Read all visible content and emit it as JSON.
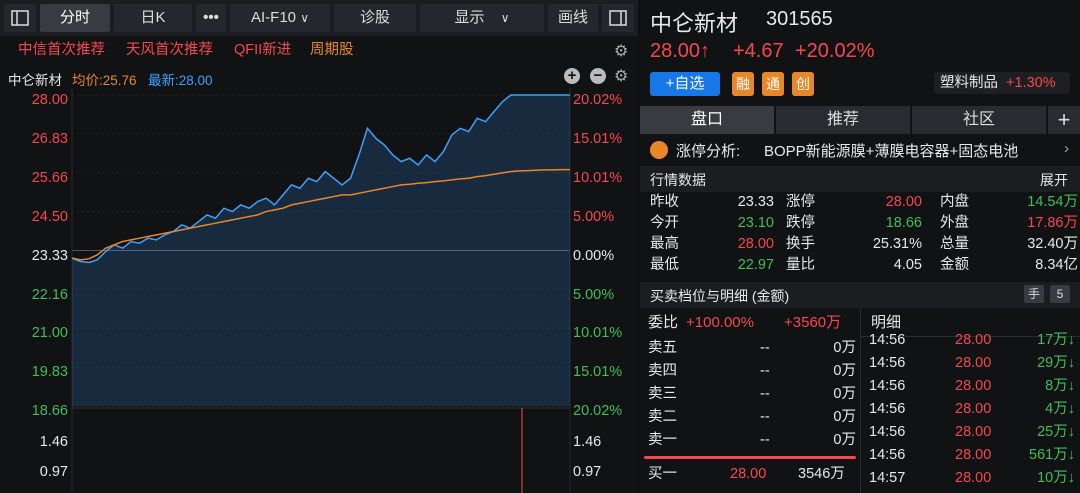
{
  "toolbar": {
    "tabs": [
      {
        "label": "分时",
        "active": true
      },
      {
        "label": "日K",
        "active": false
      },
      {
        "label": "•••",
        "active": false
      },
      {
        "label": "AI-F10",
        "active": false
      },
      {
        "label": "诊股",
        "active": false
      }
    ],
    "display_label": "显示",
    "draw_label": "画线"
  },
  "tags": [
    "中信首次推荐",
    "天风首次推荐",
    "QFII新进",
    "周期股"
  ],
  "chart_header": {
    "name": "中仑新材",
    "avg": "均价:25.76",
    "latest": "最新:28.00"
  },
  "chart_data": {
    "type": "line",
    "y_left_ticks": [
      "28.00",
      "26.83",
      "25.66",
      "24.50",
      "23.33",
      "22.16",
      "21.00",
      "19.83",
      "18.66"
    ],
    "y_right_ticks": [
      "20.02%",
      "15.01%",
      "10.01%",
      "5.00%",
      "0.00%",
      "5.00%",
      "10.01%",
      "15.01%",
      "20.02%"
    ],
    "ylim": [
      18.66,
      28.0
    ],
    "prev_close": 23.33,
    "series": [
      {
        "name": "最新",
        "color": "#3ea0ff",
        "values": [
          23.1,
          23.0,
          22.97,
          23.05,
          23.3,
          23.5,
          23.4,
          23.6,
          23.55,
          23.7,
          23.65,
          23.8,
          23.9,
          24.1,
          24.0,
          24.2,
          24.4,
          24.3,
          24.6,
          24.5,
          24.7,
          24.6,
          24.8,
          24.9,
          24.7,
          25.0,
          25.3,
          25.2,
          25.5,
          25.4,
          25.7,
          25.5,
          25.3,
          25.5,
          26.2,
          27.0,
          26.7,
          26.5,
          26.2,
          26.0,
          26.1,
          25.9,
          26.2,
          26.0,
          26.3,
          26.8,
          27.0,
          26.9,
          27.3,
          27.2,
          27.5,
          27.8,
          28.0,
          28.0,
          28.0,
          28.0,
          28.0,
          28.0,
          28.0,
          28.0
        ]
      },
      {
        "name": "均价",
        "color": "#e8862a",
        "values": [
          23.1,
          23.05,
          23.08,
          23.2,
          23.4,
          23.5,
          23.6,
          23.65,
          23.7,
          23.75,
          23.8,
          23.85,
          23.9,
          23.95,
          24.0,
          24.05,
          24.1,
          24.15,
          24.2,
          24.25,
          24.3,
          24.35,
          24.4,
          24.5,
          24.55,
          24.6,
          24.7,
          24.75,
          24.8,
          24.85,
          24.9,
          24.95,
          25.0,
          25.0,
          25.05,
          25.1,
          25.15,
          25.2,
          25.25,
          25.3,
          25.32,
          25.35,
          25.37,
          25.4,
          25.42,
          25.45,
          25.48,
          25.5,
          25.55,
          25.58,
          25.62,
          25.66,
          25.7,
          25.72,
          25.73,
          25.74,
          25.75,
          25.75,
          25.76,
          25.76
        ]
      }
    ],
    "volume_ticks": [
      "1.46",
      "0.97"
    ]
  },
  "stock": {
    "name": "中仑新材",
    "code": "301565",
    "price": "28.00↑",
    "change": "+4.67",
    "pct": "+20.02%",
    "add_label": "+自选",
    "badges": [
      "融",
      "通",
      "创"
    ],
    "sector": "塑料制品",
    "sector_pct": "+1.30%"
  },
  "tabs": [
    "盘口",
    "推荐",
    "社区",
    "+"
  ],
  "limit_analysis": {
    "label": "涨停分析:",
    "text": "BOPP新能源膜+薄膜电容器+固态电池"
  },
  "market": {
    "title": "行情数据",
    "expand": "展开",
    "rows": [
      [
        {
          "k": "昨收",
          "v": "23.33",
          "c": "white"
        },
        {
          "k": "涨停",
          "v": "28.00",
          "c": "red"
        },
        {
          "k": "内盘",
          "v": "14.54万",
          "c": "green"
        }
      ],
      [
        {
          "k": "今开",
          "v": "23.10",
          "c": "green"
        },
        {
          "k": "跌停",
          "v": "18.66",
          "c": "green"
        },
        {
          "k": "外盘",
          "v": "17.86万",
          "c": "red"
        }
      ],
      [
        {
          "k": "最高",
          "v": "28.00",
          "c": "red"
        },
        {
          "k": "换手",
          "v": "25.31%",
          "c": "white"
        },
        {
          "k": "总量",
          "v": "32.40万",
          "c": "white"
        }
      ],
      [
        {
          "k": "最低",
          "v": "22.97",
          "c": "green"
        },
        {
          "k": "量比",
          "v": "4.05",
          "c": "white"
        },
        {
          "k": "金额",
          "v": "8.34亿",
          "c": "white"
        }
      ]
    ]
  },
  "orderbook": {
    "title": "买卖档位与明细 (金额)",
    "hand_label": "手",
    "hand_num": "5",
    "ratio_label": "委比",
    "ratio": "+100.00%",
    "diff": "+3560万",
    "sells": [
      {
        "label": "卖五",
        "price": "--",
        "vol": "0万"
      },
      {
        "label": "卖四",
        "price": "--",
        "vol": "0万"
      },
      {
        "label": "卖三",
        "price": "--",
        "vol": "0万"
      },
      {
        "label": "卖二",
        "price": "--",
        "vol": "0万"
      },
      {
        "label": "卖一",
        "price": "--",
        "vol": "0万"
      }
    ],
    "buy1": {
      "label": "买一",
      "price": "28.00",
      "vol": "3546万"
    }
  },
  "detail": {
    "title": "明细",
    "rows": [
      {
        "t": "14:56",
        "p": "28.00",
        "v": "17万↓"
      },
      {
        "t": "14:56",
        "p": "28.00",
        "v": "29万↓"
      },
      {
        "t": "14:56",
        "p": "28.00",
        "v": "8万↓"
      },
      {
        "t": "14:56",
        "p": "28.00",
        "v": "4万↓"
      },
      {
        "t": "14:56",
        "p": "28.00",
        "v": "25万↓"
      },
      {
        "t": "14:56",
        "p": "28.00",
        "v": "561万↓"
      },
      {
        "t": "14:57",
        "p": "28.00",
        "v": "10万↓"
      }
    ]
  }
}
